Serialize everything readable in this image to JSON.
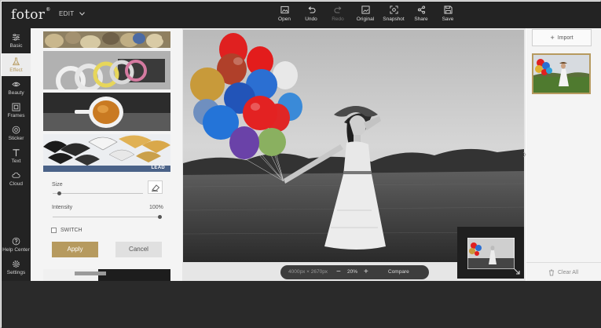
{
  "app": {
    "logo": "fotor",
    "logo_mark": "®",
    "mode": "EDIT"
  },
  "toolbar": {
    "open": "Open",
    "undo": "Undo",
    "redo": "Redo",
    "original": "Original",
    "snapshot": "Snapshot",
    "share": "Share",
    "save": "Save"
  },
  "sidebar": {
    "items": [
      {
        "label": "Basic",
        "icon": "sliders-icon"
      },
      {
        "label": "Effect",
        "icon": "flask-icon"
      },
      {
        "label": "Beauty",
        "icon": "eye-icon"
      },
      {
        "label": "Frames",
        "icon": "frame-icon"
      },
      {
        "label": "Sticker",
        "icon": "sticker-icon"
      },
      {
        "label": "Text",
        "icon": "text-icon"
      },
      {
        "label": "Cloud",
        "icon": "cloud-icon"
      }
    ],
    "help": "Help Center",
    "settings": "Settings"
  },
  "effect_panel": {
    "thumb_tag": "LEAD",
    "size_label": "Size",
    "size_fraction": 0.07,
    "intensity_label": "Intensity",
    "intensity_value": "100%",
    "switch_label": "SWITCH",
    "apply": "Apply",
    "cancel": "Cancel"
  },
  "zoombar": {
    "image_size": "4000px × 2670px",
    "minus": "−",
    "zoom": "20%",
    "plus": "+",
    "compare": "Compare"
  },
  "right_panel": {
    "import": "Import",
    "clear_all": "Clear All"
  },
  "colors": {
    "accent": "#b69a5f",
    "dark": "#232323",
    "panel": "#f4f4f4"
  }
}
